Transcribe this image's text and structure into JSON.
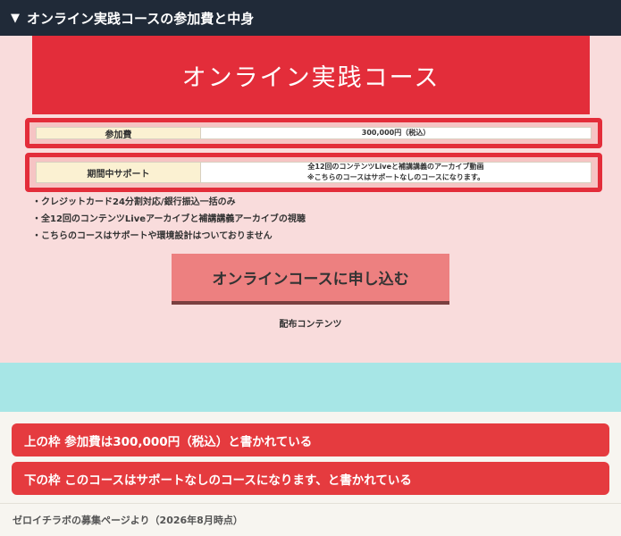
{
  "header": {
    "toggle_icon": "triangle-down-icon",
    "toggle_glyph": "▼",
    "title": "オンライン実践コースの参加費と中身"
  },
  "screenshot": {
    "banner_title": "オンライン実践コース",
    "rows": [
      {
        "label": "参加費",
        "value_lines": [
          "300,000円（税込）"
        ]
      },
      {
        "label": "期間中サポート",
        "value_lines": [
          "全12回のコンテンツLiveと補講講義のアーカイブ動画",
          "※こちらのコースはサポートなしのコースになります。"
        ]
      }
    ],
    "bullets": [
      "クレジットカード24分割対応/銀行振込一括のみ",
      "全12回のコンテンツLiveアーカイブと補講講義アーカイブの視聴",
      "こちらのコースはサポートや環境設計はついておりません"
    ],
    "apply_button": "オンラインコースに申し込む",
    "caption": "配布コンテンツ"
  },
  "notes": [
    "上の枠 参加費は300,000円（税込）と書かれている",
    "下の枠 このコースはサポートなしのコースになります、と書かれている"
  ],
  "footer": "ゼロイチラボの募集ページより（2026年8月時点）",
  "colors": {
    "header_bg": "#202a38",
    "accent_red": "#e32d3a",
    "pink_bg": "#f9dcdc",
    "teal_band": "#a7e6e6",
    "note_red": "#e53b3f"
  }
}
